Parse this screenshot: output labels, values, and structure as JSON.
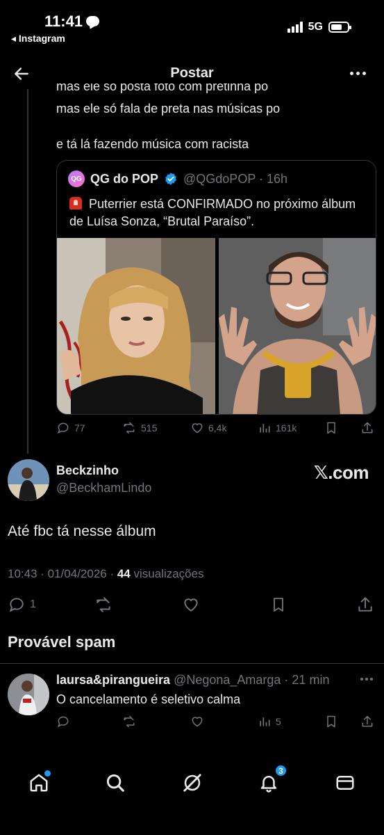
{
  "status_bar": {
    "time": "11:41",
    "back_app": "◂ Instagram",
    "network": "5G"
  },
  "header": {
    "title": "Postar"
  },
  "parent_post": {
    "cut_line": "mas ele só posta foto com pretinha po",
    "line1": "mas ele só fala de preta nas músicas po",
    "line2": "e tá lá fazendo música com racista"
  },
  "quoted": {
    "avatar_text": "QG",
    "name": "QG do POP",
    "handle_time": "@QGdoPOP · 16h",
    "text": "Puterrier está CONFIRMADO no próximo álbum de Luísa Sonza, “Brutal Paraíso”."
  },
  "parent_actions": {
    "replies": "77",
    "reposts": "515",
    "likes": "6,4k",
    "views": "161k"
  },
  "author": {
    "name": "Beckzinho",
    "handle": "@BeckhamLindo",
    "watermark": "𝕏.com"
  },
  "main_post": {
    "text": "Até fbc tá nesse álbum",
    "timestamp": "10:43 · 01/04/2026 · ",
    "views_count": "44",
    "views_label": " visualizações"
  },
  "main_actions": {
    "replies": "1"
  },
  "spam_section": {
    "title": "Provável spam"
  },
  "reply": {
    "name": "laursa&pirangueira",
    "meta": " @Negona_Amarga · 21 min",
    "text": "O cancelamento é seletivo calma",
    "views": "5"
  },
  "bottom_nav": {
    "notifications_badge": "3"
  },
  "colors": {
    "background": "#000000",
    "text": "#e7e9ea",
    "muted": "#71767b",
    "accent": "#1d9bf0",
    "border": "#2f3336"
  }
}
